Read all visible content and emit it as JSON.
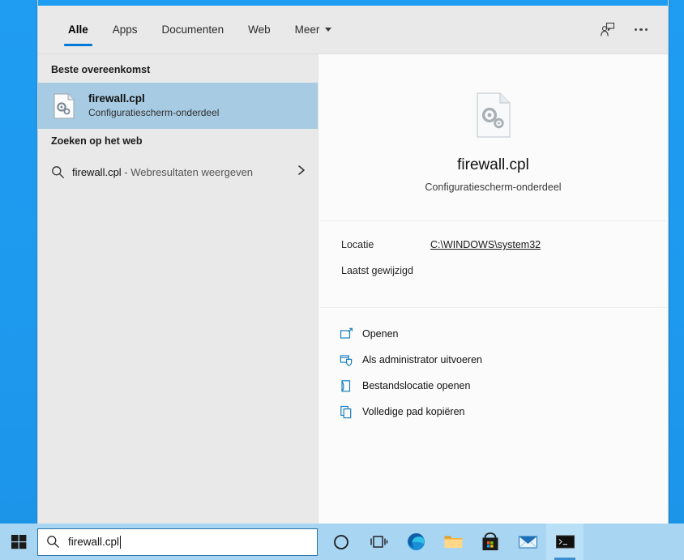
{
  "header": {
    "tabs": [
      {
        "label": "Alle",
        "active": true
      },
      {
        "label": "Apps",
        "active": false
      },
      {
        "label": "Documenten",
        "active": false
      },
      {
        "label": "Web",
        "active": false
      },
      {
        "label": "Meer",
        "active": false,
        "has_caret": true
      }
    ],
    "feedback_icon": "feedback-person-icon",
    "more_icon": "ellipsis-icon",
    "accent_color": "#0078d7"
  },
  "results": {
    "best_match_heading": "Beste overeenkomst",
    "best_match": {
      "title": "firewall.cpl",
      "subtitle": "Configuratiescherm-onderdeel",
      "icon": "cpl-file-gears-icon",
      "selected": true,
      "highlight_color": "#a7cbe2"
    },
    "web_heading": "Zoeken op het web",
    "web_item": {
      "query": "firewall.cpl",
      "suffix": " - Webresultaten weergeven",
      "icon": "search-icon",
      "chevron": "chevron-right-icon"
    }
  },
  "preview": {
    "icon": "cpl-file-gears-large-icon",
    "title": "firewall.cpl",
    "subtitle": "Configuratiescherm-onderdeel",
    "meta": [
      {
        "key": "Locatie",
        "value": "C:\\WINDOWS\\system32",
        "is_link": true
      },
      {
        "key": "Laatst gewijzigd",
        "value": "",
        "is_link": false
      }
    ],
    "actions": [
      {
        "label": "Openen",
        "icon": "open-window-icon"
      },
      {
        "label": "Als administrator uitvoeren",
        "icon": "shield-window-icon"
      },
      {
        "label": "Bestandslocatie openen",
        "icon": "folder-open-icon"
      },
      {
        "label": "Volledige pad kopiëren",
        "icon": "copy-icon"
      }
    ],
    "action_icon_color": "#1a7fc1"
  },
  "taskbar": {
    "start_icon": "windows-logo-icon",
    "search": {
      "icon": "search-icon",
      "value": "firewall.cpl",
      "placeholder": "Typ hier om te zoeken"
    },
    "icons": [
      {
        "name": "cortana-icon",
        "active": false
      },
      {
        "name": "task-view-icon",
        "active": false
      },
      {
        "name": "edge-browser-icon",
        "active": false
      },
      {
        "name": "file-explorer-icon",
        "active": false
      },
      {
        "name": "microsoft-store-icon",
        "active": false
      },
      {
        "name": "mail-icon",
        "active": false
      },
      {
        "name": "terminal-icon",
        "active": true
      }
    ],
    "background_color": "#a8d5f2"
  },
  "desktop": {
    "background_color": "#1f9df2"
  }
}
